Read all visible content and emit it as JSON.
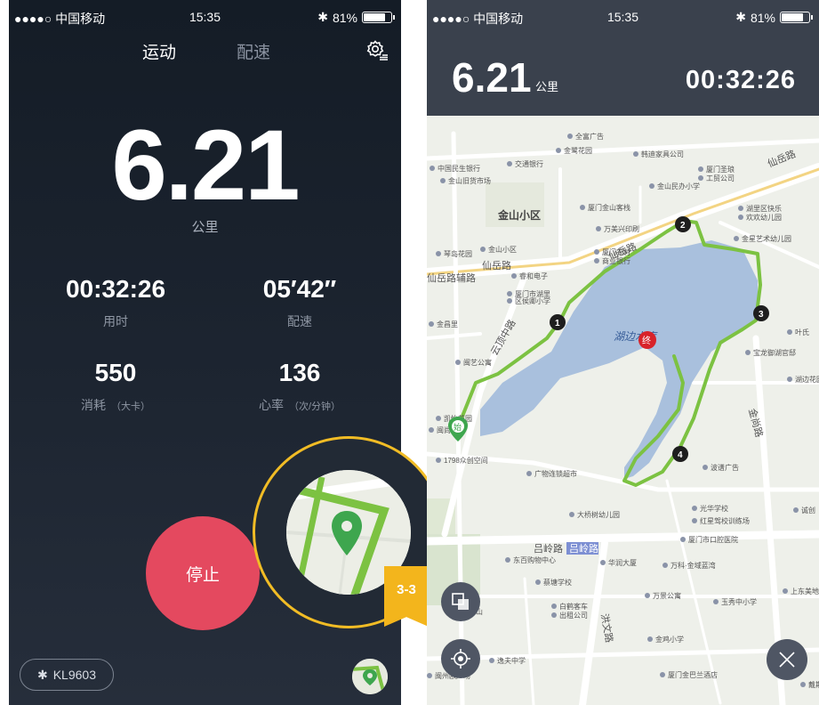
{
  "statusbar": {
    "carrier": "●●●●○ 中国移动",
    "time": "15:35",
    "battery": "81%"
  },
  "tabs": [
    {
      "label": "运动"
    },
    {
      "label": "配速"
    }
  ],
  "main": {
    "distance": "6.21",
    "distance_unit": "公里"
  },
  "stats": [
    {
      "value": "00:32:26",
      "label": "用时",
      "unit": ""
    },
    {
      "value": "05′42″",
      "label": "配速",
      "unit": ""
    },
    {
      "value": "550",
      "label": "消耗",
      "unit": "（大卡）"
    },
    {
      "value": "136",
      "label": "心率",
      "unit": "（次/分钟）"
    }
  ],
  "stop_label": "停止",
  "device": {
    "label": "KL9603"
  },
  "callout": {
    "step": "3-3"
  },
  "map_header": {
    "distance": "6.21",
    "unit": "公里",
    "time": "00:32:26"
  },
  "colors": {
    "accent_red": "#e4495f",
    "route_green": "#7cc242",
    "callout_yellow": "#f1bc25",
    "lake_blue": "#a9c0dd"
  },
  "map": {
    "roads": [
      {
        "label": "仙岳路"
      },
      {
        "label": "仙岳路"
      },
      {
        "label": "仙岳路辅路"
      },
      {
        "label": "云顶中路"
      },
      {
        "label": "吕岭路"
      },
      {
        "label": "吕岭路"
      },
      {
        "label": "洪文路"
      },
      {
        "label": "金尚路"
      },
      {
        "label": "仙岳路"
      }
    ],
    "pois": [
      {
        "label": "全富广告"
      },
      {
        "label": "金鹭花园"
      },
      {
        "label": "韩迪家具公司"
      },
      {
        "label": "交通银行"
      },
      {
        "label": "中国民生银行"
      },
      {
        "label": "金山旧货市场"
      },
      {
        "label": "厦门圣琅"
      },
      {
        "label": "工贸公司"
      },
      {
        "label": "金山民办小学"
      },
      {
        "label": "金山小区"
      },
      {
        "label": "厦门金山客栈"
      },
      {
        "label": "湖里区快乐"
      },
      {
        "label": "欢欢幼儿园"
      },
      {
        "label": "万美兴印刷"
      },
      {
        "label": "金山小区"
      },
      {
        "label": "琴岛花园"
      },
      {
        "label": "厦门农村"
      },
      {
        "label": "商业银行"
      },
      {
        "label": "金星艺术幼儿园"
      },
      {
        "label": "睿和电子"
      },
      {
        "label": "厦门市湖里"
      },
      {
        "label": "区侯卿小学"
      },
      {
        "label": "金昌里"
      },
      {
        "label": "闽艺公寓"
      },
      {
        "label": "叶氏"
      },
      {
        "label": "宝龙御湖官邸"
      },
      {
        "label": "湖边花园B区"
      },
      {
        "label": "凯怡花园"
      },
      {
        "label": "闽尚中心"
      },
      {
        "label": "1798众创空间"
      },
      {
        "label": "广物连锁超市"
      },
      {
        "label": "波谱广告"
      },
      {
        "label": "光华学校"
      },
      {
        "label": "红星驾校训练场"
      },
      {
        "label": "大桥树幼儿园"
      },
      {
        "label": "厦门市口腔医院"
      },
      {
        "label": "诚创"
      },
      {
        "label": "东百购物中心"
      },
      {
        "label": "华润大厦"
      },
      {
        "label": "万科·金域蓝湾"
      },
      {
        "label": "蔡塘学校"
      },
      {
        "label": "金山"
      },
      {
        "label": "万景公寓"
      },
      {
        "label": "玉秀中小学"
      },
      {
        "label": "上东美地"
      },
      {
        "label": "白鹤客车"
      },
      {
        "label": "出租公司"
      },
      {
        "label": "金鸡小学"
      },
      {
        "label": "逸夫中学"
      },
      {
        "label": "厦门金巴兰酒店"
      },
      {
        "label": "闽州欧广场"
      },
      {
        "label": "戴斯酒店"
      }
    ],
    "lake_label": "湖边水库",
    "start_label": "始",
    "end_label": "终",
    "markers": [
      {
        "label": "1"
      },
      {
        "label": "2"
      },
      {
        "label": "3"
      },
      {
        "label": "4"
      }
    ]
  }
}
